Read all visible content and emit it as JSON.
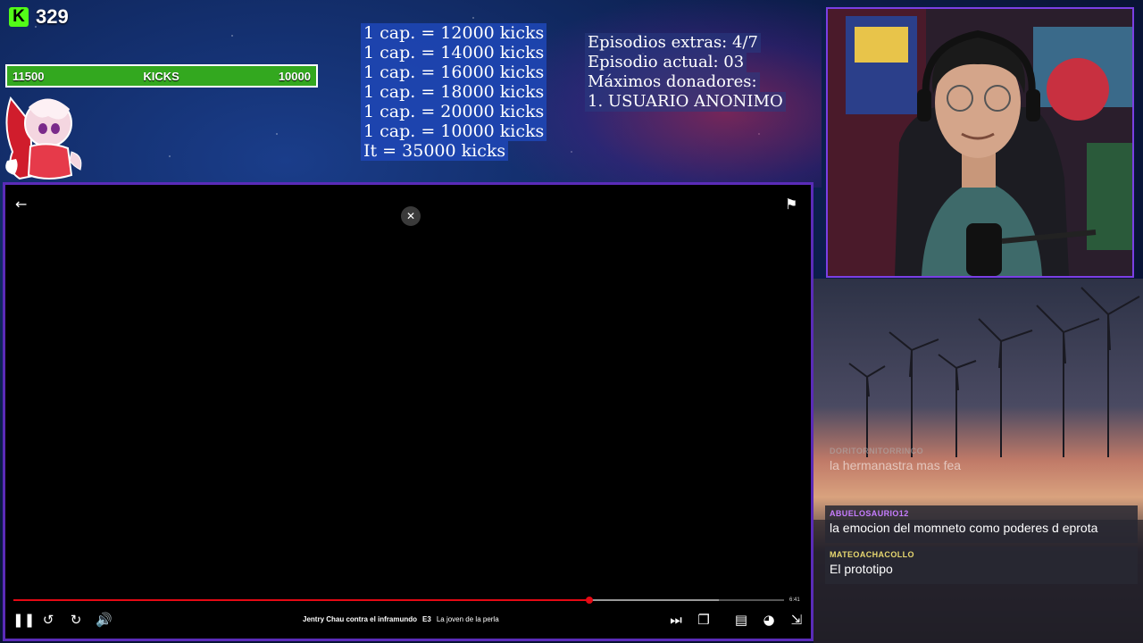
{
  "kick": {
    "logo_letter": "K",
    "count": "329"
  },
  "goal_bar": {
    "left_value": "11500",
    "label": "KICKS",
    "right_value": "10000",
    "color": "#33a81f"
  },
  "prices": [
    "1 cap. = 12000 kicks",
    "1 cap. = 14000 kicks",
    "1 cap. = 16000 kicks",
    "1 cap. = 18000 kicks",
    "1 cap. = 20000 kicks",
    "1 cap. = 10000 kicks",
    "It = 35000 kicks"
  ],
  "extras": [
    "Episodios extras: 4/7",
    "Episodio actual: 03",
    "Máximos donadores:",
    "1. USUARIO ANONIMO"
  ],
  "player": {
    "time_remaining": "6:41",
    "show_title": "Jentry Chau contra el inframundo",
    "episode_code": "E3",
    "episode_name": "La joven de la perla",
    "progress_fraction": 0.747,
    "buffer_fraction": 0.915,
    "accent_color": "#e50914"
  },
  "chat": [
    {
      "user": "DORITORNITORRINCO",
      "text": "la hermanastra mas fea",
      "user_color": "#b0b0b0"
    },
    {
      "user": "ABUELOSAURIO12",
      "text": "la emocion del momneto como poderes d eprota",
      "user_color": "#c77dff"
    },
    {
      "user": "MATEOACHACOLLO",
      "text": "El prototipo",
      "user_color": "#e8d870"
    }
  ],
  "webcam_border_color": "#7b3fe4"
}
